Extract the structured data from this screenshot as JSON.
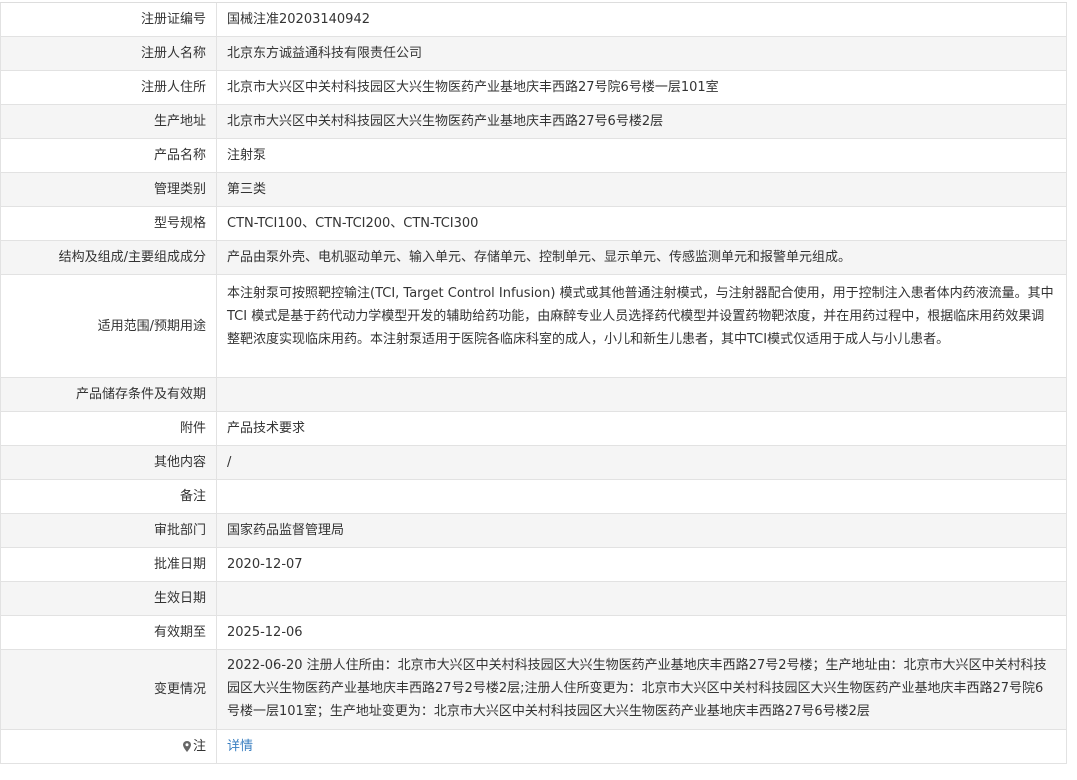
{
  "rows": [
    {
      "label": "注册证编号",
      "value": "国械注准20203140942"
    },
    {
      "label": "注册人名称",
      "value": "北京东方诚益通科技有限责任公司"
    },
    {
      "label": "注册人住所",
      "value": "北京市大兴区中关村科技园区大兴生物医药产业基地庆丰西路27号院6号楼一层101室"
    },
    {
      "label": "生产地址",
      "value": "北京市大兴区中关村科技园区大兴生物医药产业基地庆丰西路27号6号楼2层"
    },
    {
      "label": "产品名称",
      "value": "注射泵"
    },
    {
      "label": "管理类别",
      "value": "第三类"
    },
    {
      "label": "型号规格",
      "value": "CTN-TCI100、CTN-TCI200、CTN-TCI300"
    },
    {
      "label": "结构及组成/主要组成成分",
      "value": "产品由泵外壳、电机驱动单元、输入单元、存储单元、控制单元、显示单元、传感监测单元和报警单元组成。"
    },
    {
      "label": "适用范围/预期用途",
      "value": "本注射泵可按照靶控输注(TCI, Target Control Infusion) 模式或其他普通注射模式，与注射器配合使用，用于控制注入患者体内药液流量。其中TCI 模式是基于药代动力学模型开发的辅助给药功能，由麻醉专业人员选择药代模型并设置药物靶浓度，并在用药过程中，根据临床用药效果调整靶浓度实现临床用药。本注射泵适用于医院各临床科室的成人，小儿和新生儿患者，其中TCI模式仅适用于成人与小儿患者。"
    },
    {
      "label": "产品储存条件及有效期",
      "value": ""
    },
    {
      "label": "附件",
      "value": "产品技术要求"
    },
    {
      "label": "其他内容",
      "value": "/"
    },
    {
      "label": "备注",
      "value": ""
    },
    {
      "label": "审批部门",
      "value": "国家药品监督管理局"
    },
    {
      "label": "批准日期",
      "value": "2020-12-07"
    },
    {
      "label": "生效日期",
      "value": ""
    },
    {
      "label": "有效期至",
      "value": "2025-12-06"
    },
    {
      "label": "变更情况",
      "value": "2022-06-20 注册人住所由：北京市大兴区中关村科技园区大兴生物医药产业基地庆丰西路27号2号楼；生产地址由：北京市大兴区中关村科技园区大兴生物医药产业基地庆丰西路27号2号楼2层;注册人住所变更为：北京市大兴区中关村科技园区大兴生物医药产业基地庆丰西路27号院6号楼一层101室；生产地址变更为：北京市大兴区中关村科技园区大兴生物医药产业基地庆丰西路27号6号楼2层"
    },
    {
      "label": "注",
      "value": "详情"
    }
  ],
  "colors": {
    "link": "#3a7fc1",
    "alt_row_bg": "#f5f5f5",
    "border": "#e2e2e2"
  },
  "icons": {
    "note_icon": "pin-icon"
  }
}
